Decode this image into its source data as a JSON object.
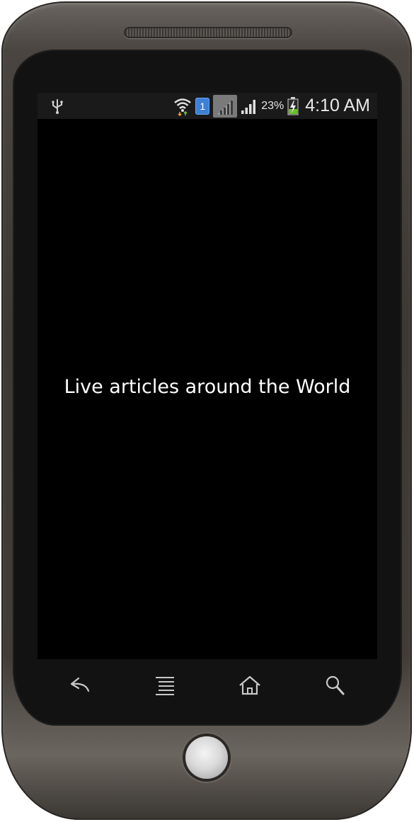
{
  "status_bar": {
    "battery_percent": "23%",
    "time": "4:10 AM",
    "sim_slot": "1",
    "icons": [
      "usb-icon",
      "wifi-icon",
      "sim-icon",
      "signal-icon",
      "battery-charging-icon"
    ]
  },
  "screen": {
    "splash_text": "Live articles around the World"
  },
  "nav_keys": [
    "back-icon",
    "menu-icon",
    "home-icon",
    "search-icon"
  ],
  "colors": {
    "screen_bg": "#000000",
    "status_bar_bg": "#1a1a1a",
    "sim_badge": "#3d7fd6",
    "battery_charge": "#6abf2a"
  }
}
